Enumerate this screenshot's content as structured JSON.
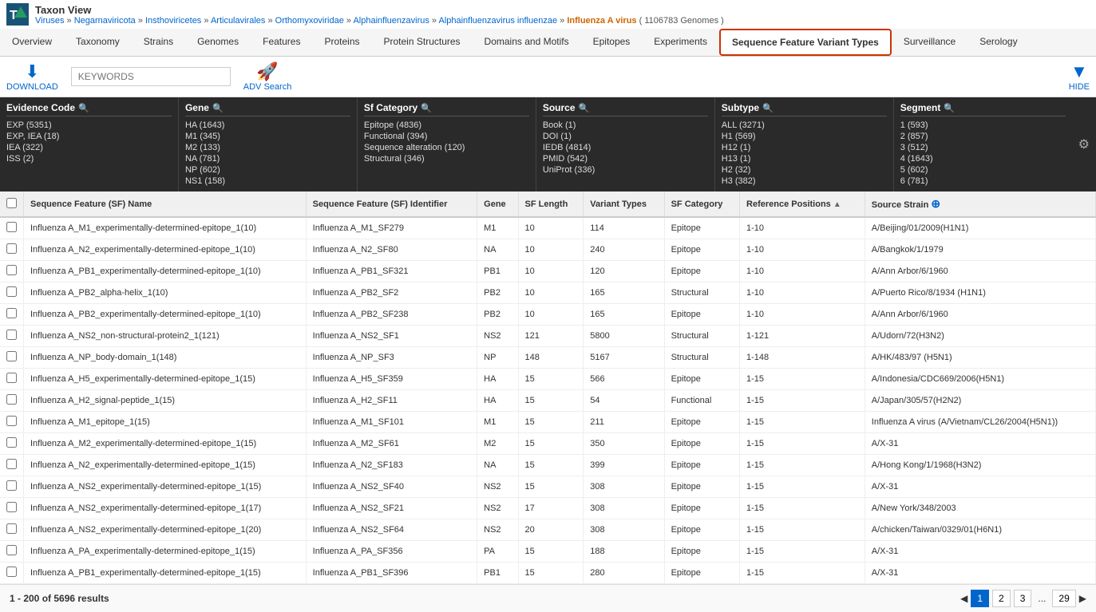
{
  "app": {
    "title": "Taxon View"
  },
  "breadcrumb": {
    "items": [
      "Viruses",
      "Negarnaviricota",
      "Insthoviricetes",
      "Articulavirales",
      "Orthomyxoviridae",
      "Alphainfluenzavirus",
      "Alphainfluenzavirus influenzae"
    ],
    "current": "Influenza A virus",
    "genome_count": "( 1106783 Genomes )"
  },
  "tabs": [
    {
      "id": "overview",
      "label": "Overview",
      "active": false
    },
    {
      "id": "taxonomy",
      "label": "Taxonomy",
      "active": false
    },
    {
      "id": "strains",
      "label": "Strains",
      "active": false
    },
    {
      "id": "genomes",
      "label": "Genomes",
      "active": false
    },
    {
      "id": "features",
      "label": "Features",
      "active": false
    },
    {
      "id": "proteins",
      "label": "Proteins",
      "active": false
    },
    {
      "id": "protein-structures",
      "label": "Protein Structures",
      "active": false
    },
    {
      "id": "domains-motifs",
      "label": "Domains and Motifs",
      "active": false
    },
    {
      "id": "epitopes",
      "label": "Epitopes",
      "active": false
    },
    {
      "id": "experiments",
      "label": "Experiments",
      "active": false
    },
    {
      "id": "sfvt",
      "label": "Sequence Feature Variant Types",
      "active": true,
      "highlighted": true
    },
    {
      "id": "surveillance",
      "label": "Surveillance",
      "active": false
    },
    {
      "id": "serology",
      "label": "Serology",
      "active": false
    }
  ],
  "toolbar": {
    "download_label": "DOWNLOAD",
    "keywords_placeholder": "KEYWORDS",
    "adv_search_label": "ADV Search",
    "hide_label": "HIDE"
  },
  "filters": {
    "evidence_code": {
      "header": "Evidence Code",
      "items": [
        "EXP (5351)",
        "EXP, IEA (18)",
        "IEA (322)",
        "ISS (2)"
      ]
    },
    "gene": {
      "header": "Gene",
      "items": [
        "HA (1643)",
        "M1 (345)",
        "M2 (133)",
        "NA (781)",
        "NP (602)",
        "NS1 (158)"
      ]
    },
    "sf_category": {
      "header": "Sf Category",
      "items": [
        "Epitope (4836)",
        "Functional (394)",
        "Sequence alteration (120)",
        "Structural (346)"
      ]
    },
    "source": {
      "header": "Source",
      "items": [
        "Book (1)",
        "DOI (1)",
        "IEDB (4814)",
        "PMID (542)",
        "UniProt (336)"
      ]
    },
    "subtype": {
      "header": "Subtype",
      "items": [
        "ALL (3271)",
        "H1 (569)",
        "H12 (1)",
        "H13 (1)",
        "H2 (32)",
        "H3 (382)"
      ]
    },
    "segment": {
      "header": "Segment",
      "items": [
        "1 (593)",
        "2 (857)",
        "3 (512)",
        "4 (1643)",
        "5 (602)",
        "6 (781)"
      ]
    }
  },
  "table": {
    "columns": [
      "Sequence Feature (SF) Name",
      "Sequence Feature (SF) Identifier",
      "Gene",
      "SF Length",
      "Variant Types",
      "SF Category",
      "Reference Positions",
      "Source Strain"
    ],
    "rows": [
      {
        "sf_name": "Influenza A_M1_experimentally-determined-epitope_1(10)",
        "sf_id": "Influenza A_M1_SF279",
        "gene": "M1",
        "sf_length": "10",
        "variant_types": "114",
        "sf_category": "Epitope",
        "ref_positions": "1-10",
        "source_strain": "A/Beijing/01/2009(H1N1)"
      },
      {
        "sf_name": "Influenza A_N2_experimentally-determined-epitope_1(10)",
        "sf_id": "Influenza A_N2_SF80",
        "gene": "NA",
        "sf_length": "10",
        "variant_types": "240",
        "sf_category": "Epitope",
        "ref_positions": "1-10",
        "source_strain": "A/Bangkok/1/1979"
      },
      {
        "sf_name": "Influenza A_PB1_experimentally-determined-epitope_1(10)",
        "sf_id": "Influenza A_PB1_SF321",
        "gene": "PB1",
        "sf_length": "10",
        "variant_types": "120",
        "sf_category": "Epitope",
        "ref_positions": "1-10",
        "source_strain": "A/Ann Arbor/6/1960"
      },
      {
        "sf_name": "Influenza A_PB2_alpha-helix_1(10)",
        "sf_id": "Influenza A_PB2_SF2",
        "gene": "PB2",
        "sf_length": "10",
        "variant_types": "165",
        "sf_category": "Structural",
        "ref_positions": "1-10",
        "source_strain": "A/Puerto Rico/8/1934 (H1N1)"
      },
      {
        "sf_name": "Influenza A_PB2_experimentally-determined-epitope_1(10)",
        "sf_id": "Influenza A_PB2_SF238",
        "gene": "PB2",
        "sf_length": "10",
        "variant_types": "165",
        "sf_category": "Epitope",
        "ref_positions": "1-10",
        "source_strain": "A/Ann Arbor/6/1960"
      },
      {
        "sf_name": "Influenza A_NS2_non-structural-protein2_1(121)",
        "sf_id": "Influenza A_NS2_SF1",
        "gene": "NS2",
        "sf_length": "121",
        "variant_types": "5800",
        "sf_category": "Structural",
        "ref_positions": "1-121",
        "source_strain": "A/Udorn/72(H3N2)"
      },
      {
        "sf_name": "Influenza A_NP_body-domain_1(148)",
        "sf_id": "Influenza A_NP_SF3",
        "gene": "NP",
        "sf_length": "148",
        "variant_types": "5167",
        "sf_category": "Structural",
        "ref_positions": "1-148",
        "source_strain": "A/HK/483/97 (H5N1)"
      },
      {
        "sf_name": "Influenza A_H5_experimentally-determined-epitope_1(15)",
        "sf_id": "Influenza A_H5_SF359",
        "gene": "HA",
        "sf_length": "15",
        "variant_types": "566",
        "sf_category": "Epitope",
        "ref_positions": "1-15",
        "source_strain": "A/Indonesia/CDC669/2006(H5N1)"
      },
      {
        "sf_name": "Influenza A_H2_signal-peptide_1(15)",
        "sf_id": "Influenza A_H2_SF11",
        "gene": "HA",
        "sf_length": "15",
        "variant_types": "54",
        "sf_category": "Functional",
        "ref_positions": "1-15",
        "source_strain": "A/Japan/305/57(H2N2)"
      },
      {
        "sf_name": "Influenza A_M1_epitope_1(15)",
        "sf_id": "Influenza A_M1_SF101",
        "gene": "M1",
        "sf_length": "15",
        "variant_types": "211",
        "sf_category": "Epitope",
        "ref_positions": "1-15",
        "source_strain": "Influenza A virus (A/Vietnam/CL26/2004(H5N1))"
      },
      {
        "sf_name": "Influenza A_M2_experimentally-determined-epitope_1(15)",
        "sf_id": "Influenza A_M2_SF61",
        "gene": "M2",
        "sf_length": "15",
        "variant_types": "350",
        "sf_category": "Epitope",
        "ref_positions": "1-15",
        "source_strain": "A/X-31"
      },
      {
        "sf_name": "Influenza A_N2_experimentally-determined-epitope_1(15)",
        "sf_id": "Influenza A_N2_SF183",
        "gene": "NA",
        "sf_length": "15",
        "variant_types": "399",
        "sf_category": "Epitope",
        "ref_positions": "1-15",
        "source_strain": "A/Hong Kong/1/1968(H3N2)"
      },
      {
        "sf_name": "Influenza A_NS2_experimentally-determined-epitope_1(15)",
        "sf_id": "Influenza A_NS2_SF40",
        "gene": "NS2",
        "sf_length": "15",
        "variant_types": "308",
        "sf_category": "Epitope",
        "ref_positions": "1-15",
        "source_strain": "A/X-31"
      },
      {
        "sf_name": "Influenza A_NS2_experimentally-determined-epitope_1(17)",
        "sf_id": "Influenza A_NS2_SF21",
        "gene": "NS2",
        "sf_length": "17",
        "variant_types": "308",
        "sf_category": "Epitope",
        "ref_positions": "1-15",
        "source_strain": "A/New York/348/2003"
      },
      {
        "sf_name": "Influenza A_NS2_experimentally-determined-epitope_1(20)",
        "sf_id": "Influenza A_NS2_SF64",
        "gene": "NS2",
        "sf_length": "20",
        "variant_types": "308",
        "sf_category": "Epitope",
        "ref_positions": "1-15",
        "source_strain": "A/chicken/Taiwan/0329/01(H6N1)"
      },
      {
        "sf_name": "Influenza A_PA_experimentally-determined-epitope_1(15)",
        "sf_id": "Influenza A_PA_SF356",
        "gene": "PA",
        "sf_length": "15",
        "variant_types": "188",
        "sf_category": "Epitope",
        "ref_positions": "1-15",
        "source_strain": "A/X-31"
      },
      {
        "sf_name": "Influenza A_PB1_experimentally-determined-epitope_1(15)",
        "sf_id": "Influenza A_PB1_SF396",
        "gene": "PB1",
        "sf_length": "15",
        "variant_types": "280",
        "sf_category": "Epitope",
        "ref_positions": "1-15",
        "source_strain": "A/X-31"
      }
    ]
  },
  "pagination": {
    "result_text": "1 - 200 of 5696 results",
    "current_page": 1,
    "pages": [
      "1",
      "2",
      "3",
      "...",
      "29"
    ]
  }
}
